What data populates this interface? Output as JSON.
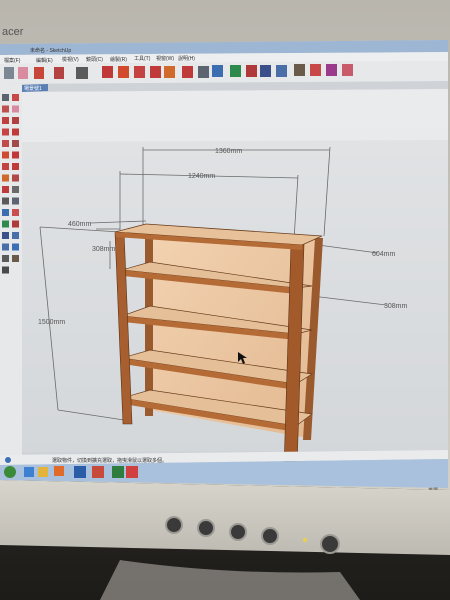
{
  "monitor": {
    "brand": "acer"
  },
  "window": {
    "title": "未命名 - SketchUp"
  },
  "menu": {
    "items": [
      "檔案(F)",
      "編輯(E)",
      "檢視(V)",
      "鏡頭(C)",
      "繪製(R)",
      "工具(T)",
      "視窗(W)",
      "說明(H)"
    ]
  },
  "scene_tab": "場景號1",
  "dimensions": {
    "overall_width": "1360mm",
    "inner_width": "1240mm",
    "depth": "460mm",
    "shelf_spacing": "308mm",
    "height": "1500mm",
    "right_top": "604mm",
    "right_mid": "308mm"
  },
  "status_bar": {
    "text": "選取物件，切換到擴充選取，拖曳滑鼠以選取多個。"
  },
  "taskbar": {
    "items": [
      "windows-start",
      "internet-explorer",
      "file-explorer",
      "media-player",
      "word",
      "sketchup-file",
      "spreadsheet",
      "sketchup"
    ],
    "tray_text": "美麗"
  }
}
